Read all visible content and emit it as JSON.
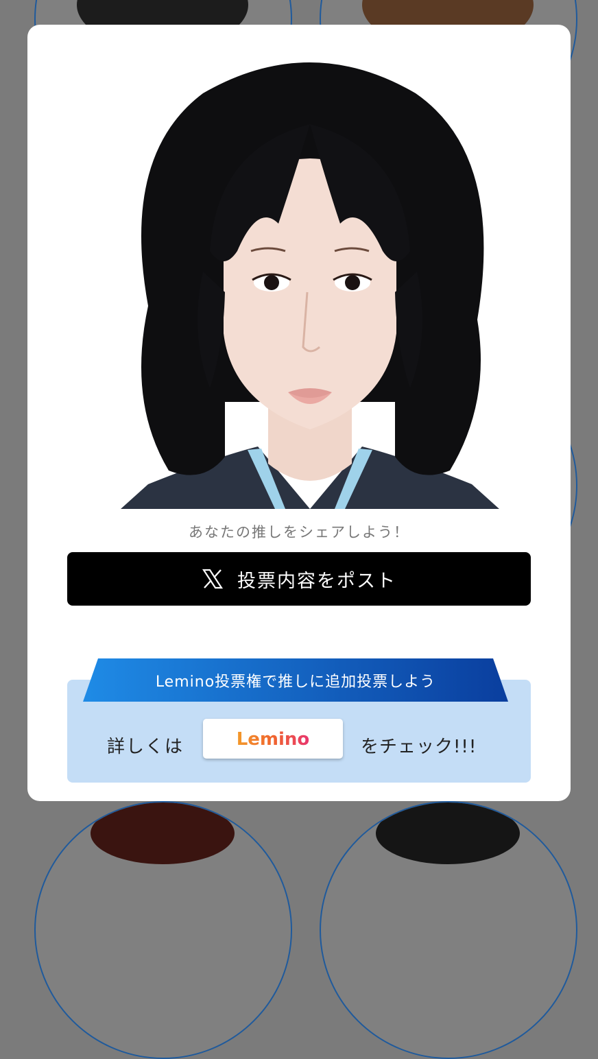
{
  "modal": {
    "share_prompt": "あなたの推しをシェアしよう！",
    "post_button_label": "投票内容をポスト",
    "post_button_icon": "x-logo-icon",
    "promo": {
      "banner_text": "Lemino投票権で推しに追加投票しよう",
      "details_prefix": "詳しくは",
      "lemino_logo_text": "Lemino",
      "details_suffix": "をチェック!!!"
    }
  },
  "colors": {
    "overlay_bg": "#7b7b7b",
    "post_button_bg": "#000000",
    "promo_bg": "#c4ddf6",
    "banner_blue": "#0d5bc4",
    "lemino_orange": "#f07a2a",
    "lemino_pink": "#e8366f"
  }
}
